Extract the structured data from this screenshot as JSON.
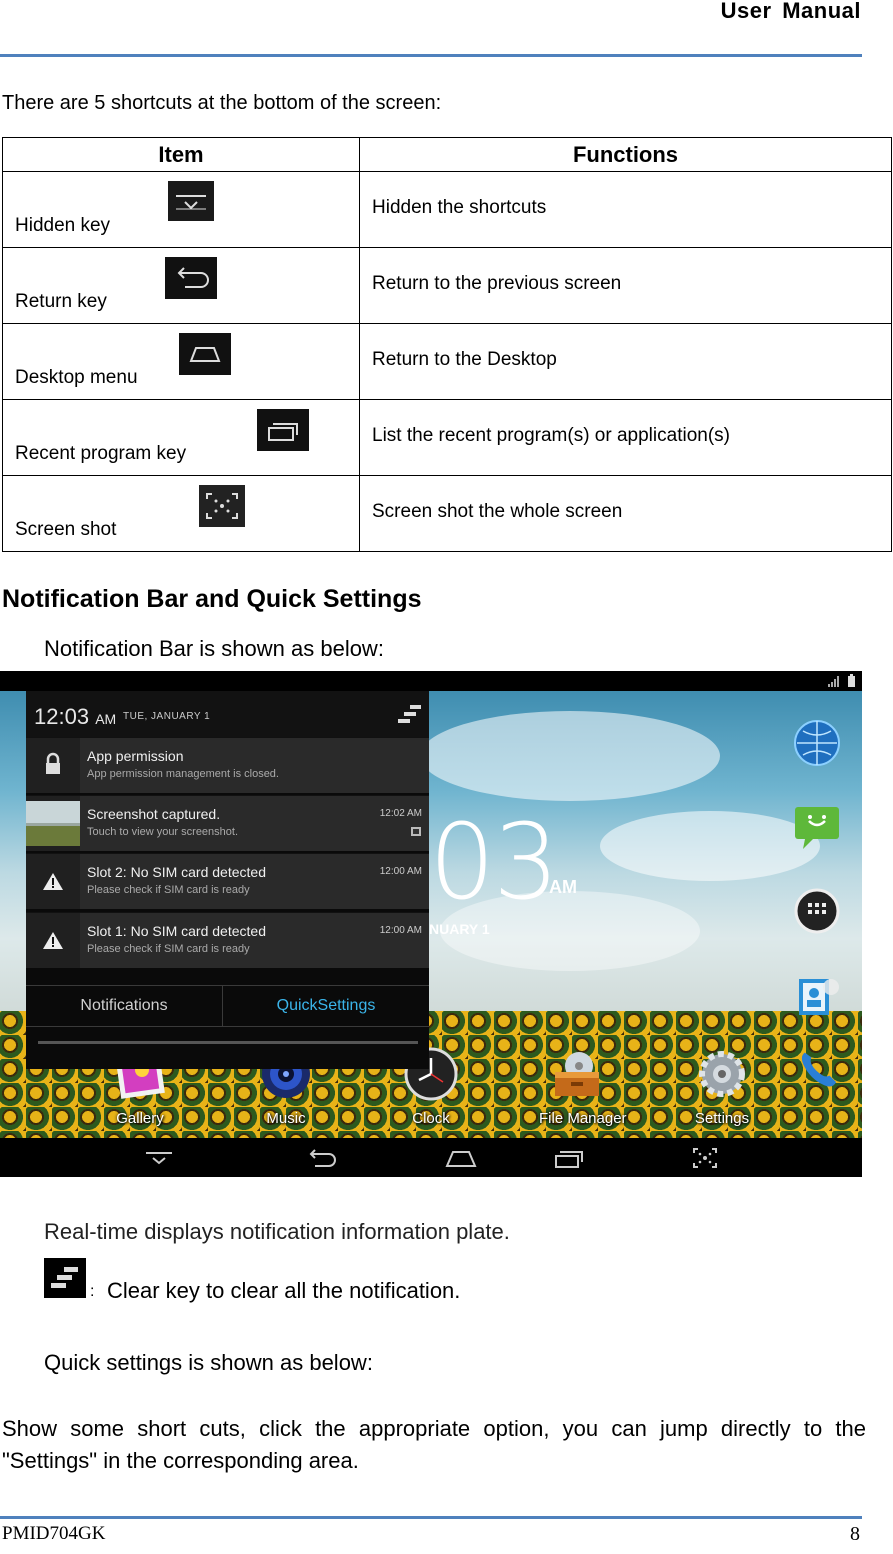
{
  "header": {
    "title": "User  Manual"
  },
  "intro": "There are 5 shortcuts at the bottom of the screen:",
  "table": {
    "headers": {
      "item": "Item",
      "functions": "Functions"
    },
    "rows": [
      {
        "item": "Hidden key",
        "function": "Hidden the shortcuts",
        "icon": "hide-icon"
      },
      {
        "item": "Return key",
        "function": "Return to the previous screen",
        "icon": "back-icon"
      },
      {
        "item": "Desktop menu",
        "function": "Return to the Desktop",
        "icon": "home-icon"
      },
      {
        "item": "Recent program key",
        "function": "List the recent program(s) or application(s)",
        "icon": "recent-apps-icon"
      },
      {
        "item": "Screen shot",
        "function": "Screen shot the whole screen",
        "icon": "screenshot-icon"
      }
    ]
  },
  "section_heading": "Notification Bar and Quick Settings",
  "notif_intro": "Notification Bar is shown as below:",
  "screenshot": {
    "time": "12:03",
    "ampm": "AM",
    "date": "TUE, JANUARY 1",
    "big_clock": "03",
    "big_ampm": "AM",
    "big_date": "NUARY 1",
    "notifications": [
      {
        "title": "App permission",
        "subtitle": "App permission management is closed.",
        "time": "",
        "icon": "lock-icon"
      },
      {
        "title": "Screenshot captured.",
        "subtitle": "Touch to view your screenshot.",
        "time": "12:02 AM",
        "icon": "screenshot-thumbnail"
      },
      {
        "title": "Slot 2: No SIM card detected",
        "subtitle": "Please check if SIM card is ready",
        "time": "12:00 AM",
        "icon": "warning-icon"
      },
      {
        "title": "Slot 1: No SIM card detected",
        "subtitle": "Please check if SIM card is ready",
        "time": "12:00 AM",
        "icon": "warning-icon"
      }
    ],
    "tabs": {
      "notifications": "Notifications",
      "quick_settings": "QuickSettings"
    },
    "dock": [
      "Gallery",
      "Music",
      "Clock",
      "File Manager",
      "Settings"
    ],
    "accent": "#3bb5ea"
  },
  "realtime_text": "Real-time displays notification information plate.",
  "clear_colon": ":",
  "clear_text": "Clear key to clear all the notification.",
  "quick_text": "Quick settings is shown as below:",
  "body_text": "Show some short cuts, click the appropriate option, you can jump directly to the \"Settings\" in the corresponding area.",
  "footer": {
    "model": "PMID704GK",
    "page": "8"
  },
  "colors": {
    "rule": "#4f81bd"
  }
}
